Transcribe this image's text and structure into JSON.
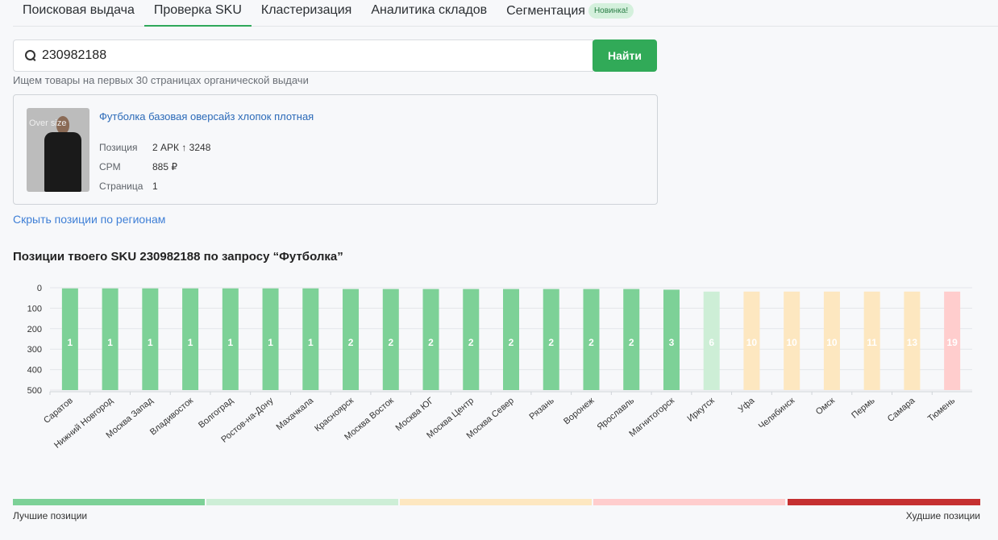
{
  "tabs": [
    {
      "label": "Поисковая выдача"
    },
    {
      "label": "Проверка SKU"
    },
    {
      "label": "Кластеризация"
    },
    {
      "label": "Аналитика складов"
    },
    {
      "label": "Сегментация"
    }
  ],
  "tab_badge": "Новинка!",
  "search": {
    "value": "230982188",
    "button": "Найти",
    "hint": "Ищем товары на первых 30 страницах органической выдачи"
  },
  "product": {
    "title": "Футболка базовая оверсайз хлопок плотная",
    "thumb_text": "Over size",
    "props": [
      {
        "label": "Позиция",
        "value": "2 АРК ↑ 3248"
      },
      {
        "label": "CPM",
        "value": "885 ₽"
      },
      {
        "label": "Страница",
        "value": "1"
      }
    ]
  },
  "toggle_link": "Скрыть позиции по регионам",
  "chart_data": {
    "type": "bar",
    "title": "Позиции твоего SKU 230982188 по запросу “Футболка”",
    "categories": [
      "Саратов",
      "Нижний Новгород",
      "Москва Запад",
      "Владивосток",
      "Волгоград",
      "Ростов-на-Дону",
      "Махачкала",
      "Красноярск",
      "Москва Восток",
      "Москва ЮГ",
      "Москва Центр",
      "Москва Север",
      "Рязань",
      "Воронеж",
      "Ярославль",
      "Магнитогорск",
      "Иркутск",
      "Уфа",
      "Челябинск",
      "Омск",
      "Пермь",
      "Самара",
      "Тюмень"
    ],
    "values": [
      1,
      1,
      1,
      1,
      1,
      1,
      1,
      2,
      2,
      2,
      2,
      2,
      2,
      2,
      2,
      3,
      6,
      10,
      10,
      10,
      11,
      13,
      19
    ],
    "ylim": [
      0,
      500
    ],
    "yticks": [
      0,
      100,
      200,
      300,
      400,
      500
    ],
    "y_inverted": true,
    "colors": {
      "best": "#7dd197",
      "good": "#cdeed6",
      "mid": "#fde7c0",
      "bad": "#ffcdcd",
      "worst": "#c53030"
    }
  },
  "legend": {
    "best_label": "Лучшие позиции",
    "worst_label": "Худшие позиции"
  }
}
